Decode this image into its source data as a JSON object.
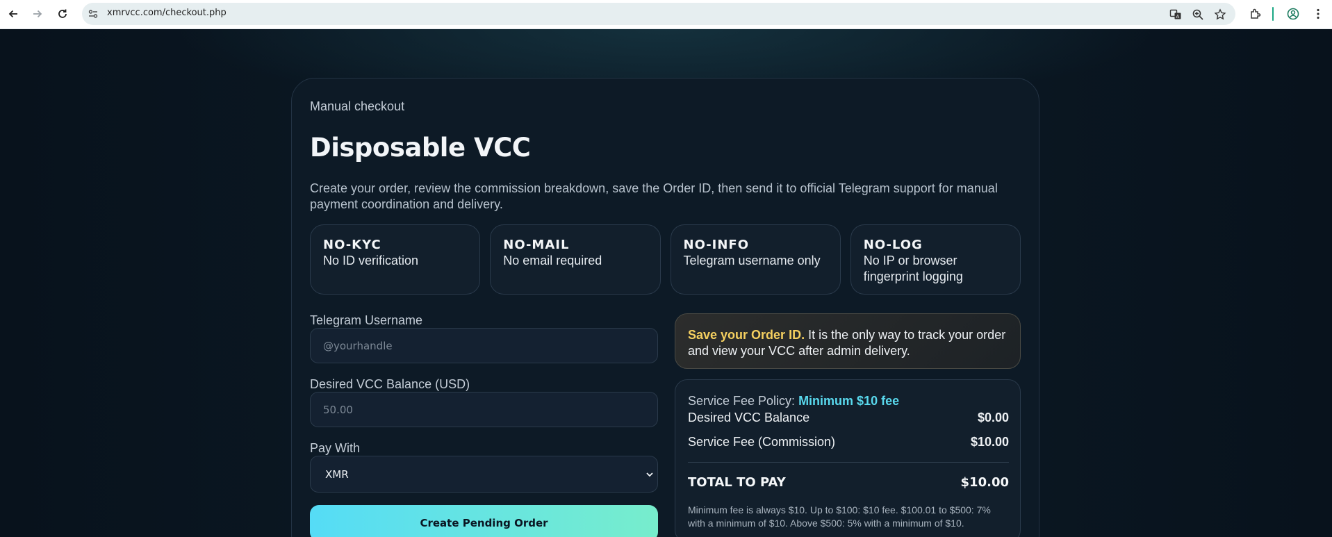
{
  "browser": {
    "url": "xmrvcc.com/checkout.php",
    "icons": [
      "back-arrow-icon",
      "forward-arrow-icon",
      "reload-icon",
      "site-settings-icon",
      "translate-icon",
      "zoom-icon",
      "bookmark-star-icon",
      "extensions-icon",
      "profile-icon",
      "menu-kebab-icon"
    ]
  },
  "header": {
    "eyebrow": "Manual checkout",
    "title": "Disposable VCC",
    "lead": "Create your order, review the commission breakdown, save the Order ID, then send it to official Telegram support for manual payment coordination and delivery."
  },
  "features": [
    {
      "title": "NO-KYC",
      "desc": "No ID verification"
    },
    {
      "title": "NO-MAIL",
      "desc": "No email required"
    },
    {
      "title": "NO-INFO",
      "desc": "Telegram username only"
    },
    {
      "title": "NO-LOG",
      "desc": "No IP or browser fingerprint logging"
    }
  ],
  "form": {
    "telegram_label": "Telegram Username",
    "telegram_placeholder": "@yourhandle",
    "balance_label": "Desired VCC Balance (USD)",
    "balance_placeholder": "50.00",
    "pay_label": "Pay With",
    "pay_selected": "XMR",
    "submit_label": "Create Pending Order"
  },
  "notice": {
    "highlight": "Save your Order ID.",
    "text": " It is the only way to track your order and view your VCC after admin delivery."
  },
  "summary": {
    "policy_label": "Service Fee Policy: ",
    "policy_value": "Minimum $10 fee",
    "balance_label": "Desired VCC Balance",
    "balance_value": "$0.00",
    "fee_label": "Service Fee (Commission)",
    "fee_value": "$10.00",
    "total_label": "TOTAL TO PAY",
    "total_value": "$10.00",
    "fine_print": "Minimum fee is always $10. Up to $100: $10 fee. $100.01 to $500: 7% with a minimum of $10. Above $500: 5% with a minimum of $10."
  },
  "colors": {
    "background": "#0a1520",
    "card": "#0d1a26",
    "accent_cyan": "#59d9ee",
    "highlight_gold": "#f5d060",
    "cta_gradient_start": "#55dcf6",
    "cta_gradient_end": "#77edcc"
  }
}
